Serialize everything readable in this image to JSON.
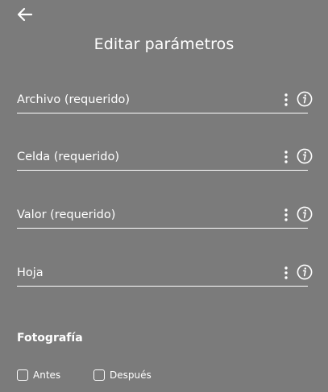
{
  "header": {
    "title": "Editar parámetros"
  },
  "fields": [
    {
      "placeholder": "Archivo (requerido)",
      "value": ""
    },
    {
      "placeholder": "Celda (requerido)",
      "value": ""
    },
    {
      "placeholder": "Valor (requerido)",
      "value": ""
    },
    {
      "placeholder": "Hoja",
      "value": ""
    }
  ],
  "section": {
    "label": "Fotografía",
    "options": [
      {
        "label": "Antes",
        "checked": false
      },
      {
        "label": "Después",
        "checked": false
      }
    ]
  },
  "icons": {
    "back": "arrow-left-icon",
    "menu": "more-vertical-icon",
    "info": "info-icon"
  },
  "colors": {
    "background": "#7b7b7b",
    "foreground": "#ffffff"
  }
}
